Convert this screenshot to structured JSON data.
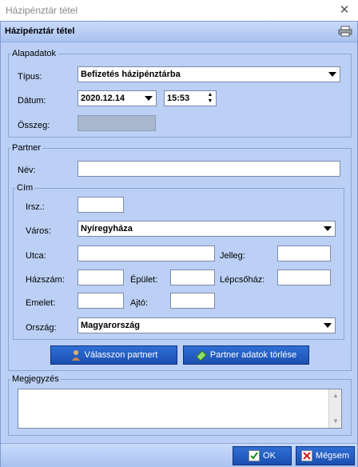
{
  "window": {
    "title": "Házipénztár tétel",
    "close": "✕"
  },
  "header": {
    "title": "Házipénztár tétel"
  },
  "alapadatok": {
    "legend": "Alapadatok",
    "tipus_label": "Típus:",
    "tipus_value": "Befizetés házipénztárba",
    "datum_label": "Dátum:",
    "datum_value": "2020.12.14",
    "time_value": "15:53",
    "osszeg_label": "Összeg:",
    "osszeg_value": ""
  },
  "partner": {
    "legend": "Partner",
    "nev_label": "Név:",
    "nev_value": "",
    "cim": {
      "legend": "Cím",
      "irsz_label": "Irsz.:",
      "irsz_value": "",
      "varos_label": "Város:",
      "varos_value": "Nyíregyháza",
      "utca_label": "Utca:",
      "utca_value": "",
      "jelleg_label": "Jelleg:",
      "jelleg_value": "",
      "hazszam_label": "Házszám:",
      "hazszam_value": "",
      "epulet_label": "Épület:",
      "epulet_value": "",
      "lepcsohaz_label": "Lépcsőház:",
      "lepcsohaz_value": "",
      "emelet_label": "Emelet:",
      "emelet_value": "",
      "ajto_label": "Ajtó:",
      "ajto_value": "",
      "orszag_label": "Ország:",
      "orszag_value": "Magyarország"
    },
    "select_partner_label": "Válasszon partnert",
    "clear_partner_label": "Partner adatok törlése"
  },
  "megjegyzes": {
    "legend": "Megjegyzés",
    "value": ""
  },
  "footer": {
    "ok_label": "OK",
    "cancel_label": "Mégsem"
  },
  "colors": {
    "accent": "#1b4fb0",
    "panel": "#bcd0f5",
    "disabled_field": "#a9b7cf"
  }
}
